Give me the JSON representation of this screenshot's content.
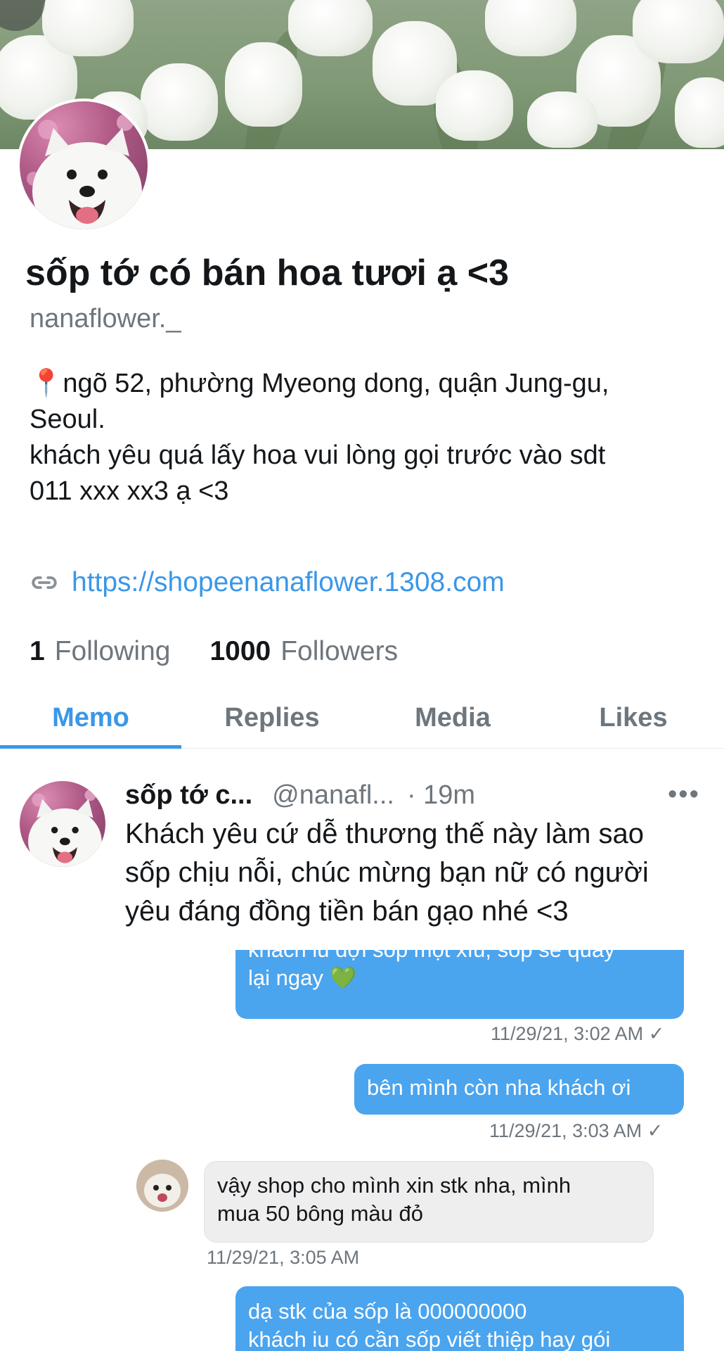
{
  "profile": {
    "display_name": "sốp tớ có bán hoa tươi ạ <3",
    "handle": "nanaflower._",
    "bio_lines": [
      "📍ngõ 52, phường Myeong dong, quận Jung-gu,",
      "Seoul.",
      "khách yêu quá lấy hoa vui lòng gọi trước vào sdt",
      "011 xxx xx3 ạ <3"
    ],
    "link": "https://shopeenanaflower.1308.com",
    "following_count": "1",
    "following_label": "Following",
    "followers_count": "1000",
    "followers_label": "Followers"
  },
  "tabs": [
    {
      "label": "Memo",
      "active": true
    },
    {
      "label": "Replies",
      "active": false
    },
    {
      "label": "Media",
      "active": false
    },
    {
      "label": "Likes",
      "active": false
    }
  ],
  "post": {
    "name": "sốp tớ c...",
    "handle": "@nanafl...",
    "time": "· 19m",
    "more": "•••",
    "text_lines": [
      "Khách yêu cứ dễ thương thế này làm sao",
      "sốp chịu nỗi, chúc mừng bạn nữ có người",
      "yêu đáng đồng tiền bán gạo nhé <3"
    ]
  },
  "chat": {
    "messages": [
      {
        "dir": "out",
        "lines": [
          "khách iu đợi sốp một xíu, sốp sẽ quay",
          "lại ngay 💚"
        ],
        "time": "11/29/21, 3:02 AM ✓"
      },
      {
        "dir": "out",
        "lines": [
          "bên mình còn nha khách ơi"
        ],
        "time": "11/29/21, 3:03 AM ✓"
      },
      {
        "dir": "in",
        "lines": [
          "vậy shop cho mình xin stk nha, mình",
          "mua 50 bông màu đỏ"
        ],
        "time": "11/29/21, 3:05 AM"
      },
      {
        "dir": "out",
        "lines": [
          "dạ stk của sốp là 000000000",
          "khách iu có cần sốp viết thiệp hay gói"
        ],
        "time": ""
      }
    ]
  },
  "colors": {
    "accent": "#3a97e8",
    "bubble_out": "#4ba4ee",
    "bubble_in": "#eeeeef",
    "muted": "#6e767d"
  }
}
